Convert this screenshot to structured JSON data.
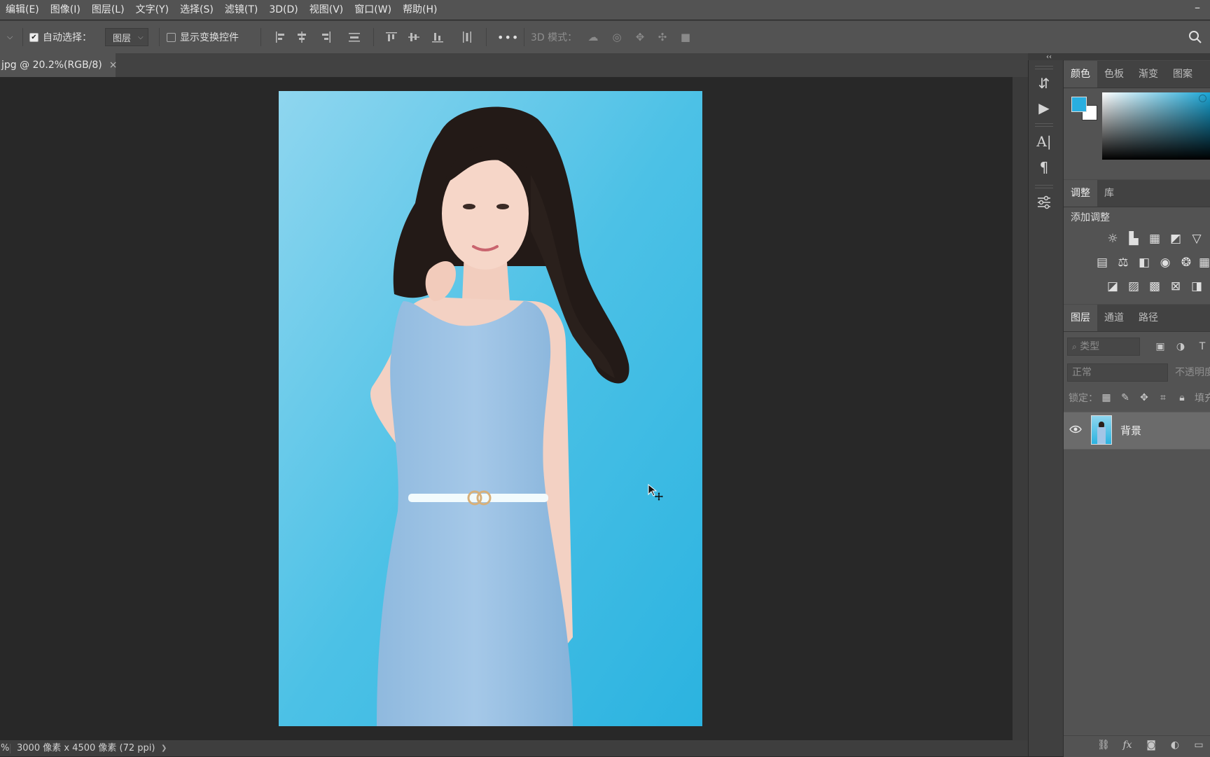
{
  "menu": {
    "items": [
      "编辑(E)",
      "图像(I)",
      "图层(L)",
      "文字(Y)",
      "选择(S)",
      "滤镜(T)",
      "3D(D)",
      "视图(V)",
      "窗口(W)",
      "帮助(H)"
    ]
  },
  "window": {
    "minimize": "–"
  },
  "options_bar": {
    "auto_select_label": "自动选择：",
    "auto_select_checked": true,
    "target_value": "图层",
    "show_transform_label": "显示变换控件",
    "show_transform_checked": false,
    "more": "•••",
    "mode_3d_label": "3D 模式："
  },
  "document": {
    "tab_title": "jpg @ 20.2%(RGB/8)",
    "close": "×"
  },
  "status": {
    "zoom_fragment": "%",
    "info": "3000 像素 x 4500 像素 (72 ppi)",
    "arrow": "❯"
  },
  "panels": {
    "collapse": "‹‹",
    "color": {
      "tabs": [
        "颜色",
        "色板",
        "渐变",
        "图案"
      ],
      "foreground": "#29aee0",
      "background": "#ffffff"
    },
    "adjust": {
      "tabs": [
        "调整",
        "库"
      ],
      "title": "添加调整"
    },
    "layers": {
      "tabs": [
        "图层",
        "通道",
        "路径"
      ],
      "filter_placeholder": "类型",
      "blend_mode": "正常",
      "opacity_label": "不透明度",
      "lock_label": "锁定：",
      "fill_label": "填充",
      "layer_name": "背景"
    }
  }
}
